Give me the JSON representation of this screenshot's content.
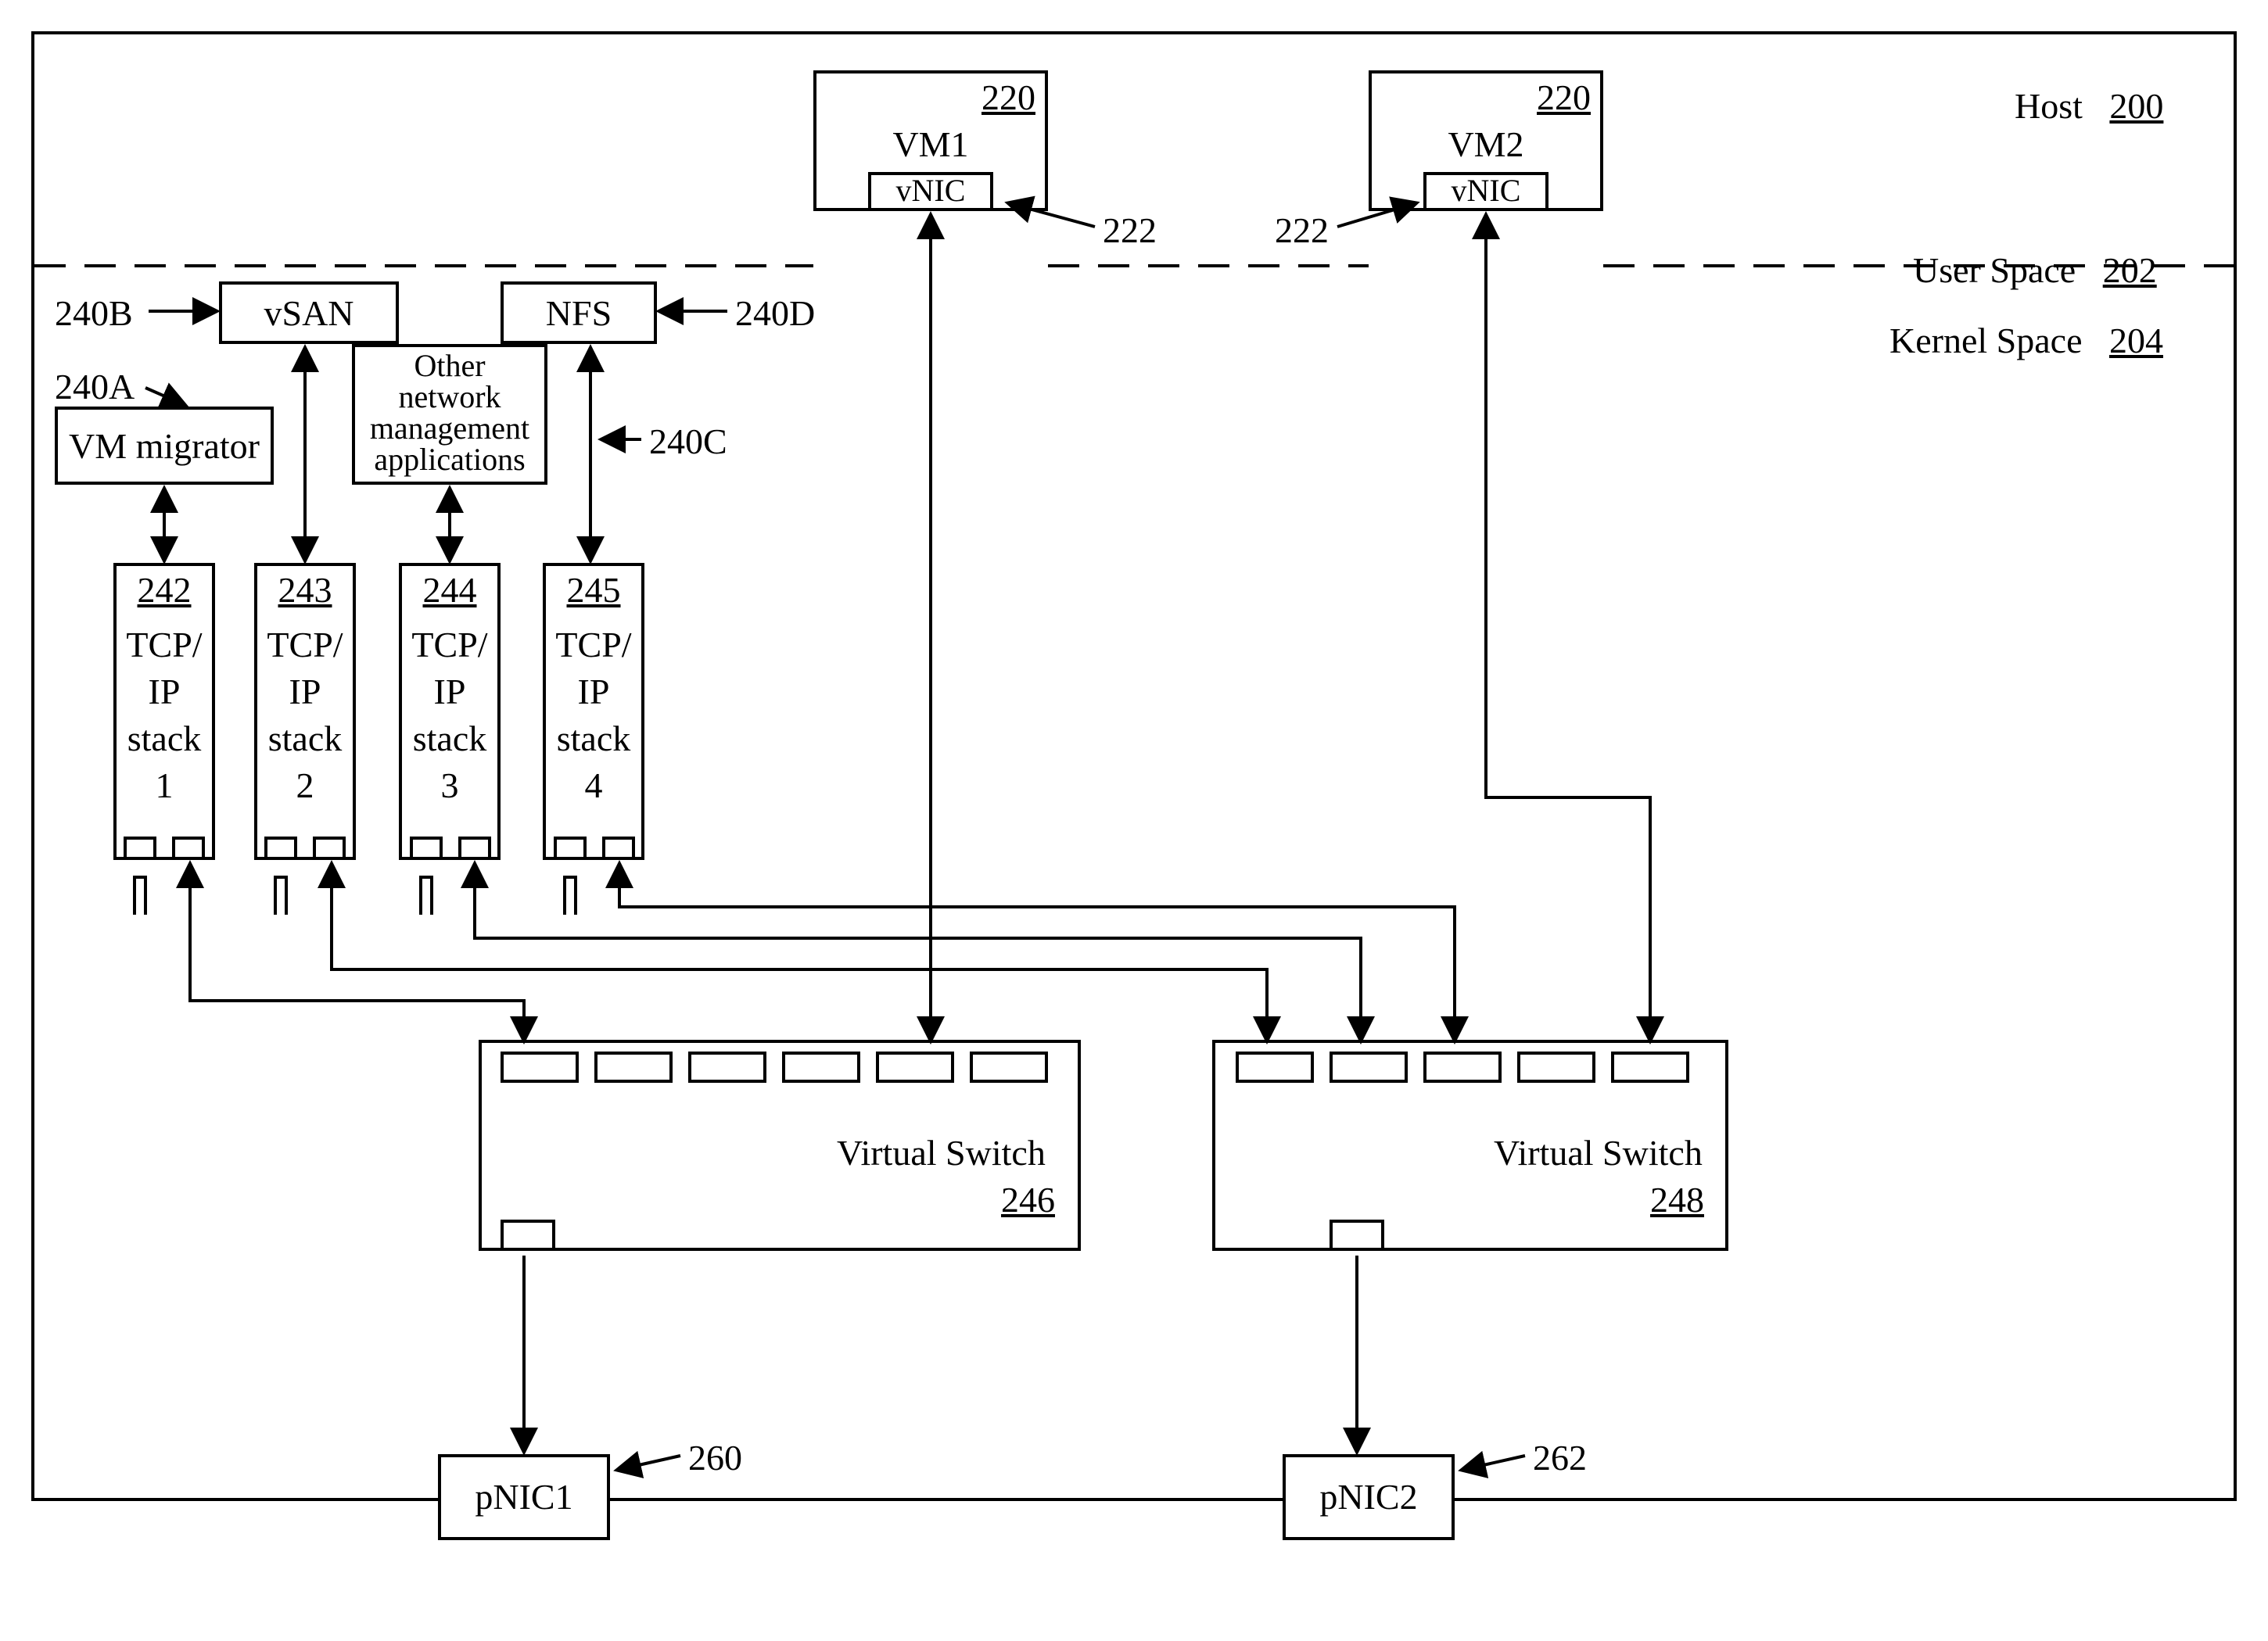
{
  "labels": {
    "host": "Host",
    "host_ref": "200",
    "user_space": "User Space",
    "user_space_ref": "202",
    "kernel_space": "Kernel Space",
    "kernel_space_ref": "204",
    "vm1": "VM1",
    "vm2": "VM2",
    "vm_ref_left": "220",
    "vm_ref_right": "220",
    "vnic": "vNIC",
    "vnic_ref_left": "222",
    "vnic_ref_right": "222",
    "vsan": "vSAN",
    "nfs": "NFS",
    "vm_migrator": "VM migrator",
    "other_apps_l1": "Other",
    "other_apps_l2": "network",
    "other_apps_l3": "management",
    "other_apps_l4": "applications",
    "ref_240A": "240A",
    "ref_240B": "240B",
    "ref_240C": "240C",
    "ref_240D": "240D",
    "stack1_ref": "242",
    "stack2_ref": "243",
    "stack3_ref": "244",
    "stack4_ref": "245",
    "tcp": "TCP/",
    "ip": "IP",
    "stack": "stack",
    "s1": "1",
    "s2": "2",
    "s3": "3",
    "s4": "4",
    "vswitch": "Virtual Switch",
    "vswitch1_ref": "246",
    "vswitch2_ref": "248",
    "pnic1": "pNIC1",
    "pnic2": "pNIC2",
    "ref_260": "260",
    "ref_262": "262"
  }
}
